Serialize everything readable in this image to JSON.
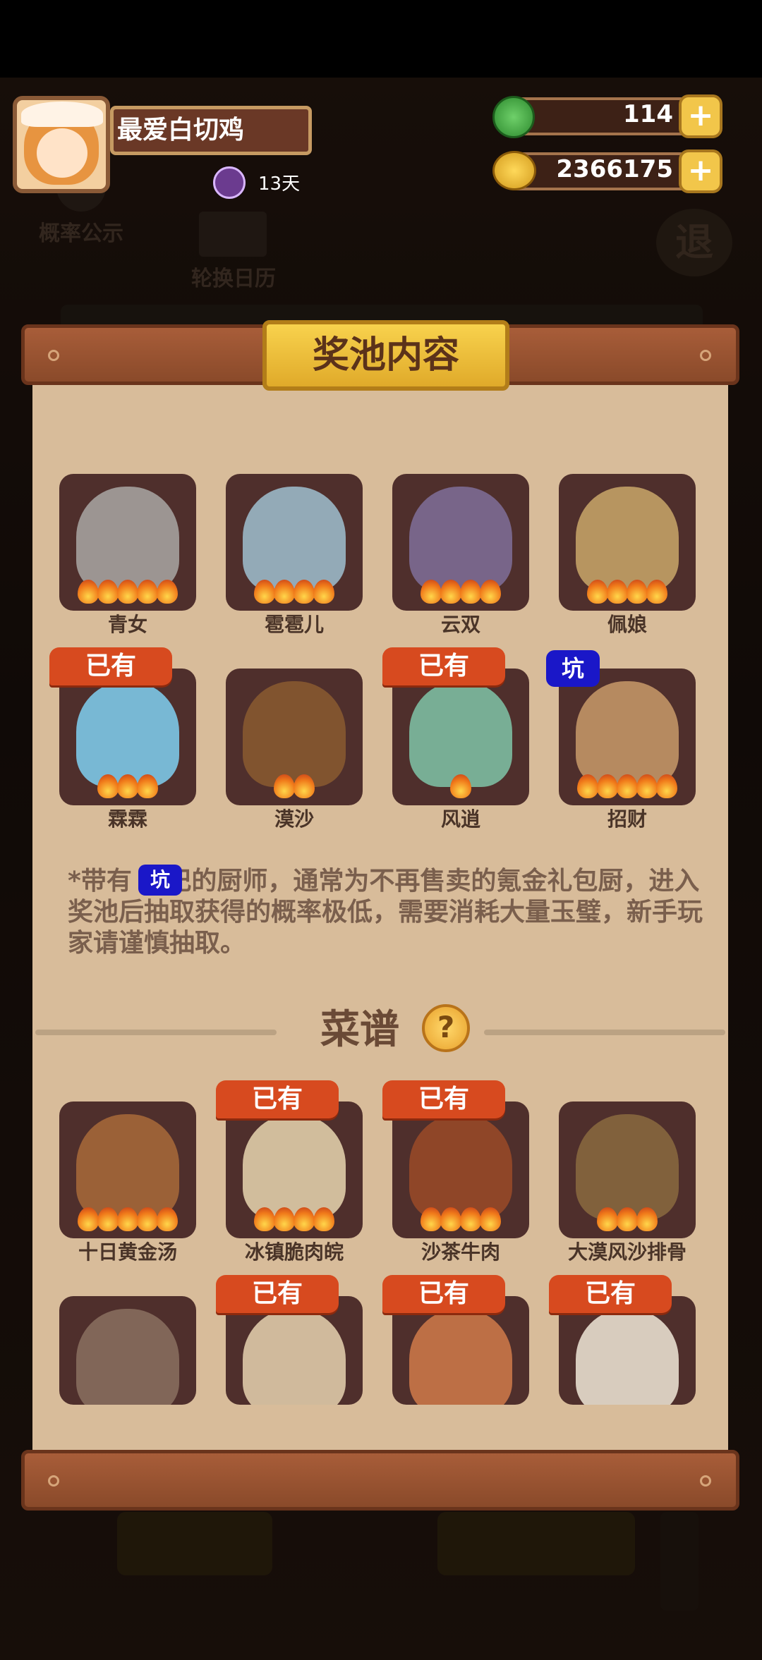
{
  "player": {
    "name": "最爱白切鸡",
    "days": "13天"
  },
  "currency": {
    "jade": "114",
    "coins": "2366175",
    "add_label": "+"
  },
  "toolbar": {
    "probability": "概率公示",
    "calendar": "轮换日历",
    "exit": "退"
  },
  "panel": {
    "title": "奖池内容"
  },
  "tags": {
    "owned": "已有",
    "pit": "坑"
  },
  "chefs": [
    {
      "name": "青女",
      "stars": 5,
      "owned": false,
      "pit": false,
      "tint": "#a9a7a4"
    },
    {
      "name": "雹雹儿",
      "stars": 4,
      "owned": false,
      "pit": false,
      "tint": "#9fc0d0"
    },
    {
      "name": "云双",
      "stars": 4,
      "owned": false,
      "pit": false,
      "tint": "#7f6f9a"
    },
    {
      "name": "佩娘",
      "stars": 4,
      "owned": false,
      "pit": false,
      "tint": "#c9a76a"
    },
    {
      "name": "霖霖",
      "stars": 3,
      "owned": true,
      "pit": false,
      "tint": "#7fd0f2"
    },
    {
      "name": "漠沙",
      "stars": 2,
      "owned": false,
      "pit": false,
      "tint": "#8a5a30"
    },
    {
      "name": "风逍",
      "stars": 1,
      "owned": true,
      "pit": false,
      "tint": "#7fc4a8"
    },
    {
      "name": "招财",
      "stars": 5,
      "owned": false,
      "pit": true,
      "tint": "#c89a6a"
    }
  ],
  "note": "*带有      标记的厨师，通常为不再售卖的氪金礼包厨，进入奖池后抽取获得的概率极低，需要消耗大量玉璧，新手玩家请谨慎抽取。",
  "recipes_title": "菜谱",
  "help_label": "?",
  "recipes": [
    {
      "name": "十日黄金汤",
      "stars": 5,
      "owned": false,
      "tint": "#a86a3a"
    },
    {
      "name": "冰镇脆肉皖",
      "stars": 4,
      "owned": true,
      "tint": "#e8d6b0"
    },
    {
      "name": "沙茶牛肉",
      "stars": 4,
      "owned": true,
      "tint": "#9a4a28"
    },
    {
      "name": "大漠风沙排骨",
      "stars": 3,
      "owned": false,
      "tint": "#8a6a40"
    },
    {
      "name": "",
      "stars": 0,
      "owned": false,
      "tint": "#8a7060"
    },
    {
      "name": "",
      "stars": 0,
      "owned": true,
      "tint": "#e6d2b0"
    },
    {
      "name": "",
      "stars": 0,
      "owned": true,
      "tint": "#d07a4a"
    },
    {
      "name": "",
      "stars": 0,
      "owned": true,
      "tint": "#f0e8d8"
    }
  ]
}
